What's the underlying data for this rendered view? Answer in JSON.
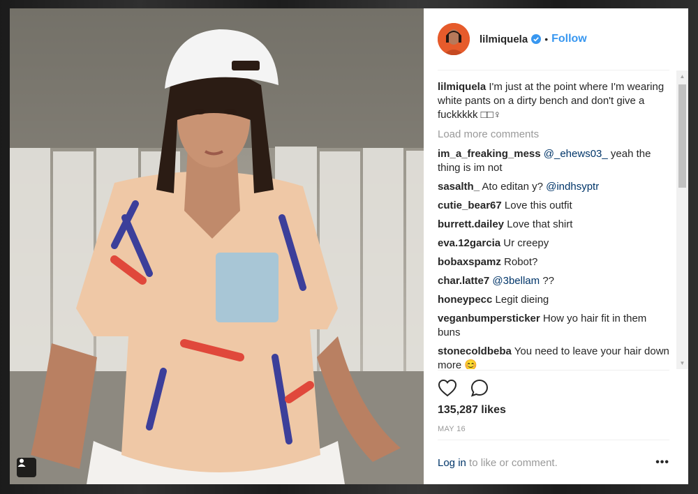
{
  "post": {
    "username": "lilmiquela",
    "follow_label": "Follow",
    "separator": "•",
    "caption_user": "lilmiquela",
    "caption_text": "I'm just at the point where I'm wearing white pants on a dirty bench and don't give a fuckkkkk □□♀",
    "load_more": "Load more comments",
    "likes": "135,287 likes",
    "date": "MAY 16",
    "login_link": "Log in",
    "login_rest": " to like or comment.",
    "more_options": "•••"
  },
  "comments": [
    {
      "user": "im_a_freaking_mess",
      "mention": "@_ehews03_",
      "text": " yeah the thing is im not"
    },
    {
      "user": "sasalth_",
      "text": "Ato editan y? ",
      "mention_after": "@indhsyptr"
    },
    {
      "user": "cutie_bear67",
      "text": "Love this outfit"
    },
    {
      "user": "burrett.dailey",
      "text": "Love that shirt"
    },
    {
      "user": "eva.12garcia",
      "text": "Ur creepy"
    },
    {
      "user": "bobaxspamz",
      "text": "Robot?"
    },
    {
      "user": "char.latte7",
      "mention": "@3bellam",
      "text": " ??"
    },
    {
      "user": "honeypecc",
      "text": "Legit dieing"
    },
    {
      "user": "veganbumpersticker",
      "text": "How yo hair fit in them buns"
    },
    {
      "user": "stonecoldbeba",
      "text": "You need to leave your hair down more 😊"
    }
  ],
  "colors": {
    "accent": "#3897f0",
    "link": "#003569",
    "muted": "#999999",
    "text": "#262626"
  },
  "icons": [
    "heart-icon",
    "comment-icon",
    "verified-badge-icon",
    "user-tag-icon"
  ]
}
